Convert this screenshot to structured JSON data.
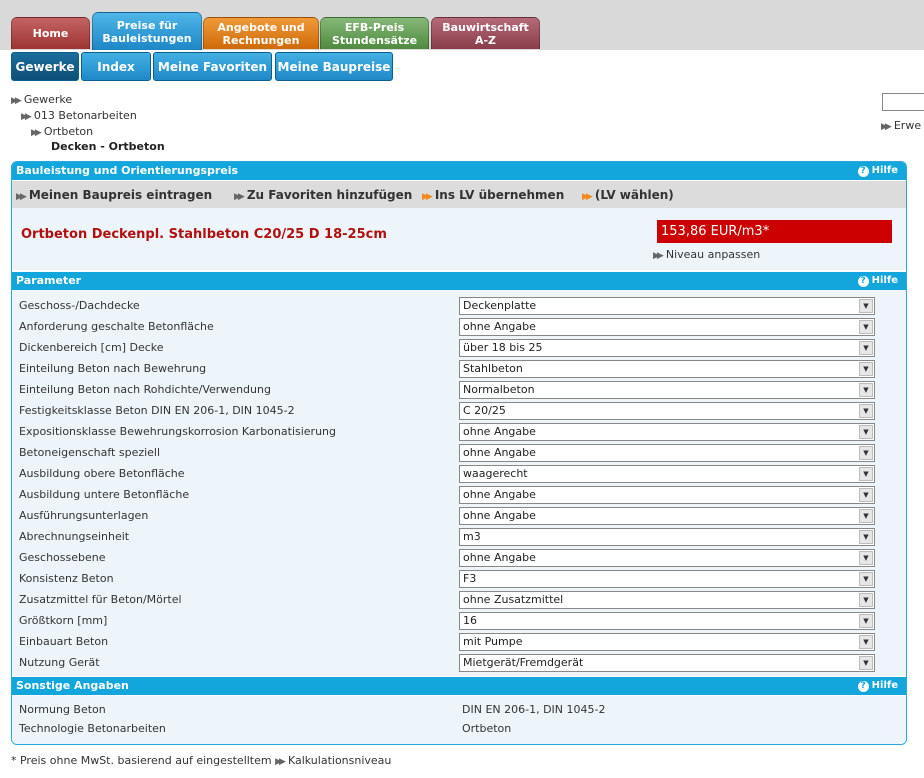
{
  "nav": {
    "main_tabs": [
      {
        "label1": "Home",
        "label2": ""
      },
      {
        "label1": "Preise für",
        "label2": "Bauleistungen"
      },
      {
        "label1": "Angebote und",
        "label2": "Rechnungen"
      },
      {
        "label1": "EFB-Preis",
        "label2": "Stundensätze"
      },
      {
        "label1": "Bauwirtschaft",
        "label2": "A-Z"
      }
    ],
    "sub_tabs": [
      "Gewerke",
      "Index",
      "Meine Favoriten",
      "Meine Baupreise"
    ]
  },
  "breadcrumb": {
    "level1": "Gewerke",
    "level2": "013 Betonarbeiten",
    "level3": "Ortbeton",
    "current": "Decken - Ortbeton"
  },
  "side": {
    "erwe": "Erwe"
  },
  "panel": {
    "header": "Bauleistung und Orientierungspreis",
    "hilfe": "Hilfe",
    "toolbar": {
      "eintragen": "Meinen Baupreis eintragen",
      "favoriten": "Zu Favoriten hinzufügen",
      "lv_uebernehmen": "Ins LV übernehmen",
      "lv_waehlen": "(LV wählen)"
    },
    "product_title": "Ortbeton Deckenpl. Stahlbeton C20/25 D 18-25cm",
    "price": "153,86  EUR/m3*",
    "niveau": "Niveau anpassen"
  },
  "parameter": {
    "header": "Parameter",
    "hilfe": "Hilfe",
    "rows": [
      {
        "label": "Geschoss-/Dachdecke",
        "value": "Deckenplatte"
      },
      {
        "label": "Anforderung geschalte Betonfläche",
        "value": "ohne Angabe"
      },
      {
        "label": "Dickenbereich [cm] Decke",
        "value": "über 18 bis 25"
      },
      {
        "label": "Einteilung Beton nach Bewehrung",
        "value": "Stahlbeton"
      },
      {
        "label": "Einteilung Beton nach Rohdichte/Verwendung",
        "value": "Normalbeton"
      },
      {
        "label": "Festigkeitsklasse Beton DIN EN 206-1, DIN 1045-2",
        "value": "C 20/25"
      },
      {
        "label": "Expositionsklasse Bewehrungskorrosion Karbonatisierung",
        "value": "ohne Angabe"
      },
      {
        "label": "Betoneigenschaft speziell",
        "value": "ohne Angabe"
      },
      {
        "label": "Ausbildung obere Betonfläche",
        "value": "waagerecht"
      },
      {
        "label": "Ausbildung untere Betonfläche",
        "value": "ohne Angabe"
      },
      {
        "label": "Ausführungsunterlagen",
        "value": "ohne Angabe"
      },
      {
        "label": "Abrechnungseinheit",
        "value": "m3"
      },
      {
        "label": "Geschossebene",
        "value": "ohne Angabe"
      },
      {
        "label": "Konsistenz Beton",
        "value": "F3"
      },
      {
        "label": "Zusatzmittel für Beton/Mörtel",
        "value": "ohne Zusatzmittel"
      },
      {
        "label": "Größtkorn [mm]",
        "value": "16"
      },
      {
        "label": "Einbauart Beton",
        "value": "mit Pumpe"
      },
      {
        "label": "Nutzung Gerät",
        "value": "Mietgerät/Fremdgerät"
      }
    ]
  },
  "sonstige": {
    "header": "Sonstige Angaben",
    "hilfe": "Hilfe",
    "rows": [
      {
        "label": "Normung Beton",
        "value": "DIN EN 206-1, DIN 1045-2"
      },
      {
        "label": "Technologie Betonarbeiten",
        "value": "Ortbeton"
      }
    ]
  },
  "footer": {
    "note": "* Preis ohne MwSt. basierend auf eingestelltem",
    "link": "Kalkulationsniveau"
  }
}
